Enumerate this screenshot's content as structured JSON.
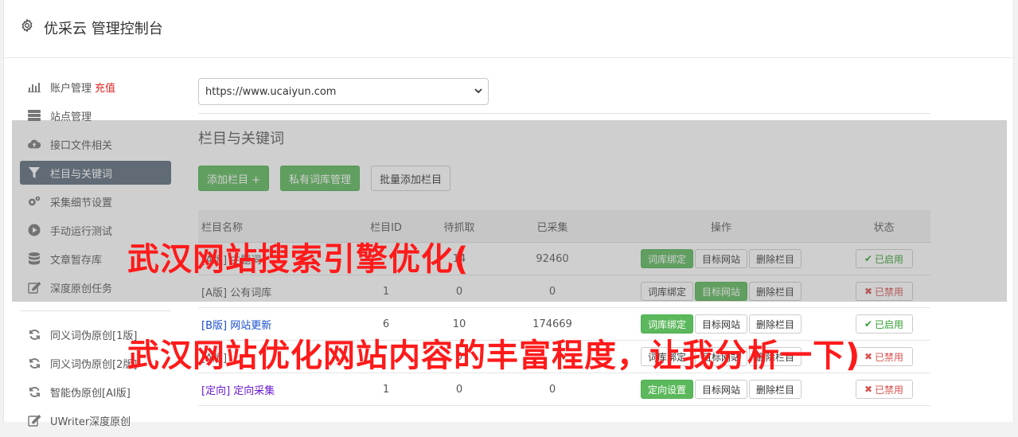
{
  "header": {
    "title": "优采云 管理控制台"
  },
  "sidebar": {
    "items": [
      {
        "label": "账户管理",
        "extra": "充值",
        "icon": "bar-chart-icon"
      },
      {
        "label": "站点管理",
        "icon": "server-icon"
      },
      {
        "label": "接口文件相关",
        "icon": "cloud-upload-icon"
      },
      {
        "label": "栏目与关键词",
        "icon": "filter-icon",
        "active": true
      },
      {
        "label": "采集细节设置",
        "icon": "cogs-icon"
      },
      {
        "label": "手动运行测试",
        "icon": "play-circle-icon"
      },
      {
        "label": "文章暂存库",
        "icon": "database-icon"
      },
      {
        "label": "深度原创任务",
        "icon": "edit-icon"
      }
    ],
    "items2": [
      {
        "label": "同义词伪原创[1版]",
        "icon": "refresh-icon"
      },
      {
        "label": "同义词伪原创[2版]",
        "icon": "refresh-icon"
      },
      {
        "label": "智能伪原创[AI版]",
        "icon": "refresh-icon"
      },
      {
        "label": "UWriter深度原创",
        "icon": "edit-icon"
      }
    ]
  },
  "main": {
    "site_select": {
      "value": "https://www.ucaiyun.com"
    },
    "section_title": "栏目与关键词",
    "buttons": {
      "add": "添加栏目 +",
      "private": "私有词库管理",
      "batch": "批量添加栏目"
    },
    "table": {
      "headers": {
        "name": "栏目名称",
        "id": "栏目ID",
        "pending": "待抓取",
        "collected": "已采集",
        "ops": "操作",
        "status": "状态"
      },
      "rows": [
        {
          "tag": "[A版]",
          "name": "主题词",
          "id": "",
          "pending": "14",
          "collected": "92460",
          "op1": "词库绑定",
          "op2": "目标网站",
          "op3": "删除栏目",
          "status": "已启用",
          "status_on": true
        },
        {
          "tag": "[A版]",
          "name": "公有词库",
          "id": "1",
          "pending": "0",
          "collected": "0",
          "op1": "词库绑定",
          "op2": "目标网站",
          "op3": "删除栏目",
          "status": "已禁用",
          "status_on": false
        },
        {
          "tag": "[B版]",
          "name": "网站更新",
          "id": "6",
          "pending": "10",
          "collected": "174669",
          "op1": "词库绑定",
          "op2": "目标网站",
          "op3": "删除栏目",
          "status": "已启用",
          "status_on": true
        },
        {
          "tag": "[A版]",
          "name": "",
          "id": "",
          "pending": "0",
          "collected": "",
          "op1": "词库绑定",
          "op2": "目标网站",
          "op3": "删除栏目",
          "status": "已禁用",
          "status_on": false
        },
        {
          "tag": "[定向]",
          "name": "定向采集",
          "id": "1",
          "pending": "0",
          "collected": "0",
          "op1": "定向设置",
          "op2": "目标网站",
          "op3": "删除栏目",
          "status": "已禁用",
          "status_on": false
        }
      ]
    }
  },
  "overlay_text": {
    "line1": "武汉网站搜索引擎优化(",
    "line2": "武汉网站优化网站内容的丰富程度，让我分析一下)"
  },
  "colors": {
    "accent_green": "#5cb85c",
    "active_nav": "#5a6a7a",
    "headline_red": "#ff1a1a"
  }
}
